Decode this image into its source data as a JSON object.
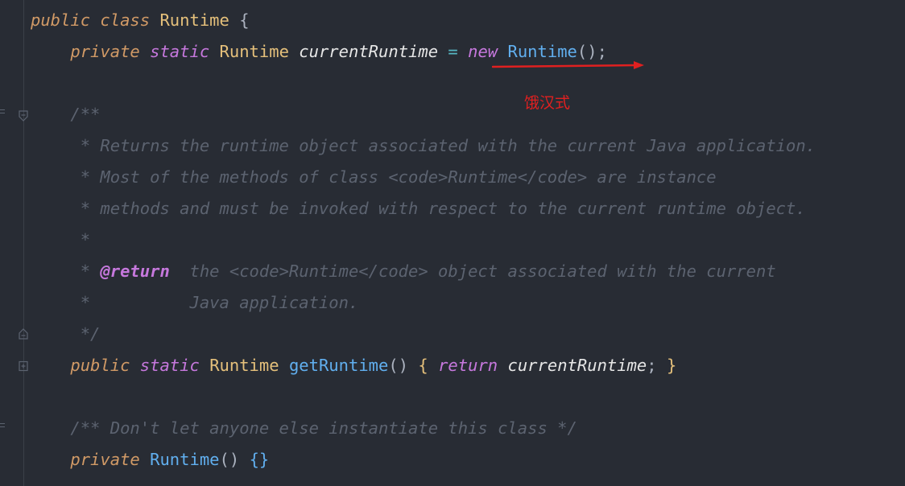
{
  "editor": {
    "lines": [
      {
        "id": "l1",
        "tokens": [
          {
            "t": "public",
            "c": "t-class-kw"
          },
          {
            "t": " "
          },
          {
            "t": "class",
            "c": "t-class-kw"
          },
          {
            "t": " "
          },
          {
            "t": "Runtime",
            "c": "t-type"
          },
          {
            "t": " "
          },
          {
            "t": "{",
            "c": "t-punct"
          }
        ]
      },
      {
        "id": "l2",
        "tokens": [
          {
            "t": "    "
          },
          {
            "t": "private",
            "c": "t-class-kw"
          },
          {
            "t": " "
          },
          {
            "t": "static",
            "c": "t-keyword"
          },
          {
            "t": " "
          },
          {
            "t": "Runtime",
            "c": "t-type"
          },
          {
            "t": " "
          },
          {
            "t": "currentRuntime",
            "c": "t-field"
          },
          {
            "t": " "
          },
          {
            "t": "=",
            "c": "t-op"
          },
          {
            "t": " "
          },
          {
            "t": "new",
            "c": "t-keyword"
          },
          {
            "t": " "
          },
          {
            "t": "Runtime",
            "c": "t-ctor"
          },
          {
            "t": "();",
            "c": "t-punct"
          }
        ]
      },
      {
        "id": "l3",
        "tokens": []
      },
      {
        "id": "l4",
        "tokens": [
          {
            "t": "    "
          },
          {
            "t": "/**",
            "c": "t-comment"
          }
        ]
      },
      {
        "id": "l5",
        "tokens": [
          {
            "t": "     "
          },
          {
            "t": "* Returns the runtime object associated with the current Java application.",
            "c": "t-comment"
          }
        ]
      },
      {
        "id": "l6",
        "tokens": [
          {
            "t": "     "
          },
          {
            "t": "* Most of the methods of class <code>Runtime</code> are instance",
            "c": "t-comment"
          }
        ]
      },
      {
        "id": "l7",
        "tokens": [
          {
            "t": "     "
          },
          {
            "t": "* methods and must be invoked with respect to the current runtime object.",
            "c": "t-comment"
          }
        ]
      },
      {
        "id": "l8",
        "tokens": [
          {
            "t": "     "
          },
          {
            "t": "*",
            "c": "t-comment"
          }
        ]
      },
      {
        "id": "l9",
        "tokens": [
          {
            "t": "     "
          },
          {
            "t": "* ",
            "c": "t-comment"
          },
          {
            "t": "@return",
            "c": "t-doctag"
          },
          {
            "t": "  the <code>Runtime</code> object associated with the current",
            "c": "t-comment"
          }
        ]
      },
      {
        "id": "l10",
        "tokens": [
          {
            "t": "     "
          },
          {
            "t": "*          Java application.",
            "c": "t-comment"
          }
        ]
      },
      {
        "id": "l11",
        "tokens": [
          {
            "t": "     "
          },
          {
            "t": "*/",
            "c": "t-comment"
          }
        ]
      },
      {
        "id": "l12",
        "tokens": [
          {
            "t": "    "
          },
          {
            "t": "public",
            "c": "t-class-kw"
          },
          {
            "t": " "
          },
          {
            "t": "static",
            "c": "t-keyword"
          },
          {
            "t": " "
          },
          {
            "t": "Runtime",
            "c": "t-type"
          },
          {
            "t": " "
          },
          {
            "t": "getRuntime",
            "c": "t-method"
          },
          {
            "t": "()",
            "c": "t-punct"
          },
          {
            "t": " "
          },
          {
            "t": "{",
            "c": "t-brace"
          },
          {
            "t": " "
          },
          {
            "t": "return",
            "c": "t-keyword"
          },
          {
            "t": " "
          },
          {
            "t": "currentRuntime",
            "c": "t-field"
          },
          {
            "t": ";",
            "c": "t-semi"
          },
          {
            "t": " "
          },
          {
            "t": "}",
            "c": "t-brace"
          }
        ]
      },
      {
        "id": "l13",
        "tokens": []
      },
      {
        "id": "l14",
        "tokens": [
          {
            "t": "    "
          },
          {
            "t": "/** Don't let anyone else instantiate this class */",
            "c": "t-comment"
          }
        ]
      },
      {
        "id": "l15",
        "tokens": [
          {
            "t": "    "
          },
          {
            "t": "private",
            "c": "t-class-kw"
          },
          {
            "t": " "
          },
          {
            "t": "Runtime",
            "c": "t-ctor-blue"
          },
          {
            "t": "()",
            "c": "t-punct"
          },
          {
            "t": " "
          },
          {
            "t": "{}",
            "c": "t-ctor-blue"
          }
        ]
      }
    ]
  },
  "annotation": {
    "label": "饿汉式",
    "color": "#e02020"
  },
  "gutter_icons": [
    "fold-collapse-icon",
    "fold-end-icon",
    "fold-expand-icon"
  ],
  "colors": {
    "background": "#282c34",
    "comment": "#5c6370",
    "keyword": "#c678dd",
    "type": "#e5c07b",
    "method": "#61afef"
  }
}
